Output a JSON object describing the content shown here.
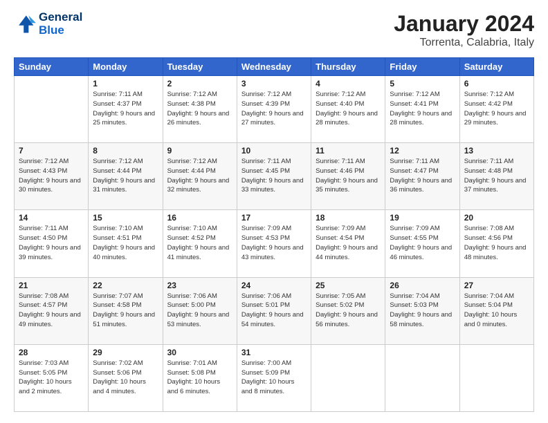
{
  "header": {
    "logo_line1": "General",
    "logo_line2": "Blue",
    "month": "January 2024",
    "location": "Torrenta, Calabria, Italy"
  },
  "days_of_week": [
    "Sunday",
    "Monday",
    "Tuesday",
    "Wednesday",
    "Thursday",
    "Friday",
    "Saturday"
  ],
  "weeks": [
    [
      {
        "day": "",
        "info": ""
      },
      {
        "day": "1",
        "info": "Sunrise: 7:11 AM\nSunset: 4:37 PM\nDaylight: 9 hours\nand 25 minutes."
      },
      {
        "day": "2",
        "info": "Sunrise: 7:12 AM\nSunset: 4:38 PM\nDaylight: 9 hours\nand 26 minutes."
      },
      {
        "day": "3",
        "info": "Sunrise: 7:12 AM\nSunset: 4:39 PM\nDaylight: 9 hours\nand 27 minutes."
      },
      {
        "day": "4",
        "info": "Sunrise: 7:12 AM\nSunset: 4:40 PM\nDaylight: 9 hours\nand 28 minutes."
      },
      {
        "day": "5",
        "info": "Sunrise: 7:12 AM\nSunset: 4:41 PM\nDaylight: 9 hours\nand 28 minutes."
      },
      {
        "day": "6",
        "info": "Sunrise: 7:12 AM\nSunset: 4:42 PM\nDaylight: 9 hours\nand 29 minutes."
      }
    ],
    [
      {
        "day": "7",
        "info": "Sunrise: 7:12 AM\nSunset: 4:43 PM\nDaylight: 9 hours\nand 30 minutes."
      },
      {
        "day": "8",
        "info": "Sunrise: 7:12 AM\nSunset: 4:44 PM\nDaylight: 9 hours\nand 31 minutes."
      },
      {
        "day": "9",
        "info": "Sunrise: 7:12 AM\nSunset: 4:44 PM\nDaylight: 9 hours\nand 32 minutes."
      },
      {
        "day": "10",
        "info": "Sunrise: 7:11 AM\nSunset: 4:45 PM\nDaylight: 9 hours\nand 33 minutes."
      },
      {
        "day": "11",
        "info": "Sunrise: 7:11 AM\nSunset: 4:46 PM\nDaylight: 9 hours\nand 35 minutes."
      },
      {
        "day": "12",
        "info": "Sunrise: 7:11 AM\nSunset: 4:47 PM\nDaylight: 9 hours\nand 36 minutes."
      },
      {
        "day": "13",
        "info": "Sunrise: 7:11 AM\nSunset: 4:48 PM\nDaylight: 9 hours\nand 37 minutes."
      }
    ],
    [
      {
        "day": "14",
        "info": "Sunrise: 7:11 AM\nSunset: 4:50 PM\nDaylight: 9 hours\nand 39 minutes."
      },
      {
        "day": "15",
        "info": "Sunrise: 7:10 AM\nSunset: 4:51 PM\nDaylight: 9 hours\nand 40 minutes."
      },
      {
        "day": "16",
        "info": "Sunrise: 7:10 AM\nSunset: 4:52 PM\nDaylight: 9 hours\nand 41 minutes."
      },
      {
        "day": "17",
        "info": "Sunrise: 7:09 AM\nSunset: 4:53 PM\nDaylight: 9 hours\nand 43 minutes."
      },
      {
        "day": "18",
        "info": "Sunrise: 7:09 AM\nSunset: 4:54 PM\nDaylight: 9 hours\nand 44 minutes."
      },
      {
        "day": "19",
        "info": "Sunrise: 7:09 AM\nSunset: 4:55 PM\nDaylight: 9 hours\nand 46 minutes."
      },
      {
        "day": "20",
        "info": "Sunrise: 7:08 AM\nSunset: 4:56 PM\nDaylight: 9 hours\nand 48 minutes."
      }
    ],
    [
      {
        "day": "21",
        "info": "Sunrise: 7:08 AM\nSunset: 4:57 PM\nDaylight: 9 hours\nand 49 minutes."
      },
      {
        "day": "22",
        "info": "Sunrise: 7:07 AM\nSunset: 4:58 PM\nDaylight: 9 hours\nand 51 minutes."
      },
      {
        "day": "23",
        "info": "Sunrise: 7:06 AM\nSunset: 5:00 PM\nDaylight: 9 hours\nand 53 minutes."
      },
      {
        "day": "24",
        "info": "Sunrise: 7:06 AM\nSunset: 5:01 PM\nDaylight: 9 hours\nand 54 minutes."
      },
      {
        "day": "25",
        "info": "Sunrise: 7:05 AM\nSunset: 5:02 PM\nDaylight: 9 hours\nand 56 minutes."
      },
      {
        "day": "26",
        "info": "Sunrise: 7:04 AM\nSunset: 5:03 PM\nDaylight: 9 hours\nand 58 minutes."
      },
      {
        "day": "27",
        "info": "Sunrise: 7:04 AM\nSunset: 5:04 PM\nDaylight: 10 hours\nand 0 minutes."
      }
    ],
    [
      {
        "day": "28",
        "info": "Sunrise: 7:03 AM\nSunset: 5:05 PM\nDaylight: 10 hours\nand 2 minutes."
      },
      {
        "day": "29",
        "info": "Sunrise: 7:02 AM\nSunset: 5:06 PM\nDaylight: 10 hours\nand 4 minutes."
      },
      {
        "day": "30",
        "info": "Sunrise: 7:01 AM\nSunset: 5:08 PM\nDaylight: 10 hours\nand 6 minutes."
      },
      {
        "day": "31",
        "info": "Sunrise: 7:00 AM\nSunset: 5:09 PM\nDaylight: 10 hours\nand 8 minutes."
      },
      {
        "day": "",
        "info": ""
      },
      {
        "day": "",
        "info": ""
      },
      {
        "day": "",
        "info": ""
      }
    ]
  ]
}
